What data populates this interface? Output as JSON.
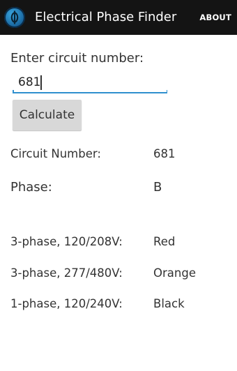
{
  "app_bar": {
    "title": "Electrical Phase Finder",
    "about_label": "ABOUT",
    "icon": "phase-logo-icon"
  },
  "form": {
    "prompt": "Enter circuit number:",
    "input_value": "681",
    "calculate_label": "Calculate"
  },
  "results": {
    "circuit_number_label": "Circuit Number:",
    "circuit_number_value": "681",
    "phase_label": "Phase:",
    "phase_value": "B",
    "colors": [
      {
        "label": "3-phase, 120/208V:",
        "value": "Red"
      },
      {
        "label": "3-phase, 277/480V:",
        "value": "Orange"
      },
      {
        "label": "1-phase, 120/240V:",
        "value": "Black"
      }
    ]
  },
  "theme": {
    "app_bar_bg": "#141414",
    "accent": "#2f8fce",
    "button_bg": "#d8d8d8"
  }
}
